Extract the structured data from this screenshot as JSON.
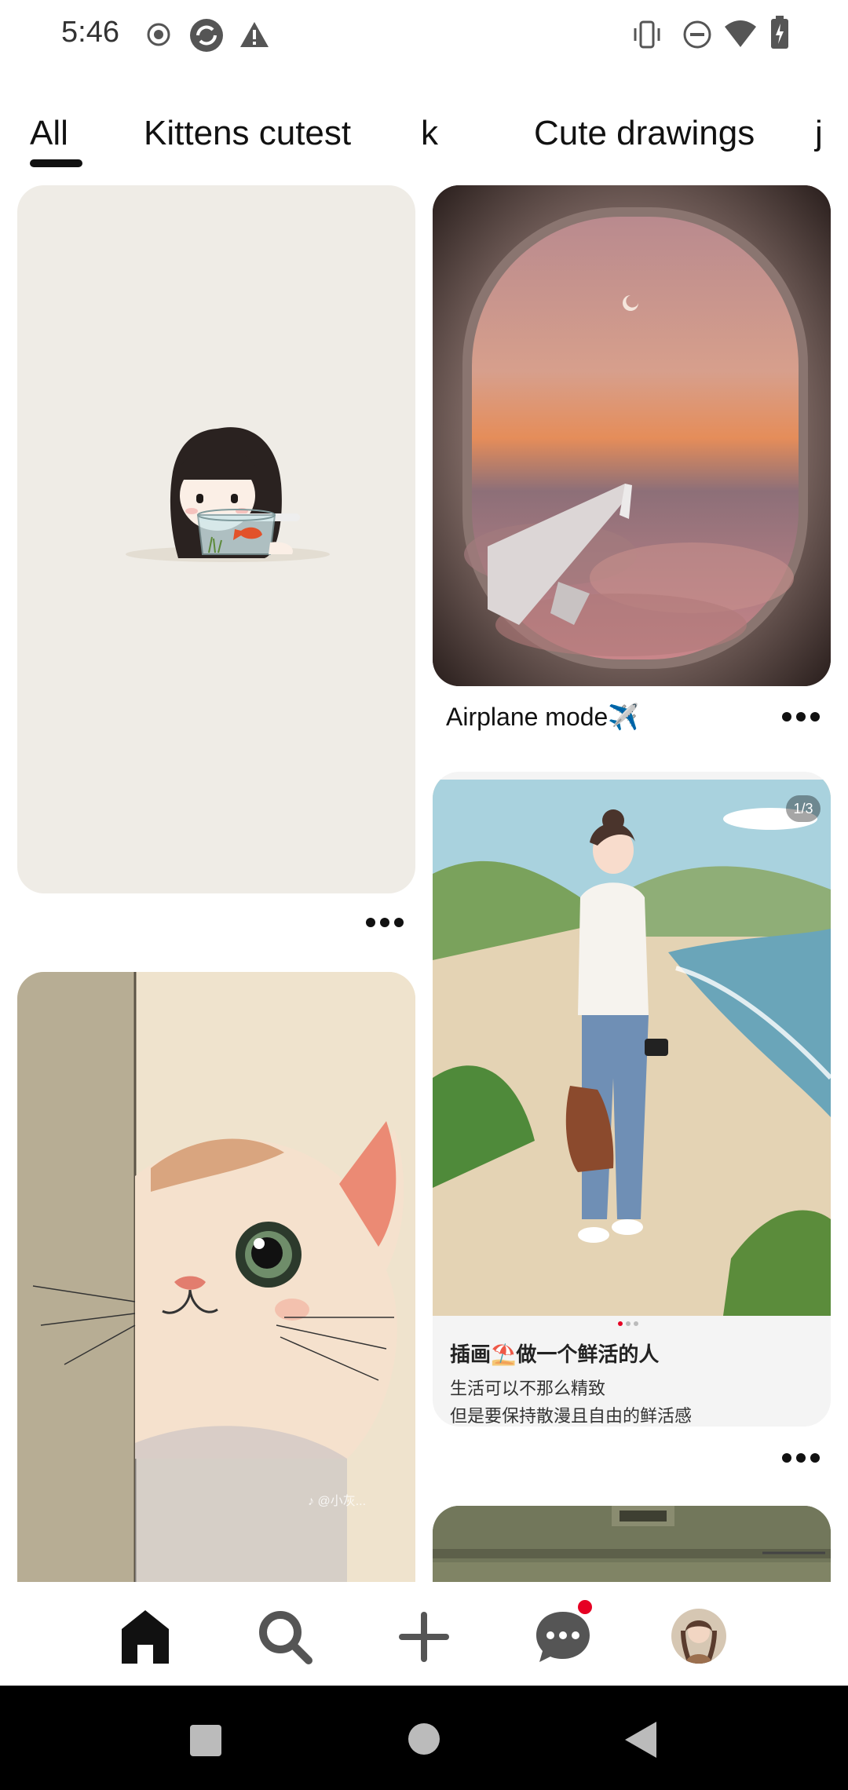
{
  "status_bar": {
    "time": "5:46",
    "left_icons": [
      "record-icon",
      "sync-icon",
      "alert-icon"
    ],
    "right_icons": [
      "vibrate-icon",
      "dnd-icon",
      "wifi-icon",
      "battery-charging-icon"
    ]
  },
  "tabs": [
    {
      "label": "All",
      "selected": true
    },
    {
      "label": "Kittens cutest",
      "selected": false
    },
    {
      "label": "k",
      "selected": false
    },
    {
      "label": "Cute drawings",
      "selected": false
    },
    {
      "label": "j",
      "selected": false
    }
  ],
  "pins": {
    "girl_fishbowl": {
      "title": ""
    },
    "airplane": {
      "title": "Airplane mode✈️"
    },
    "beach_girl": {
      "page_indicator": "1/3",
      "title": "插画⛱️做一个鲜活的人",
      "line1": "生活可以不那么精致",
      "line2": "但是要保持散漫且自由的鲜活感"
    },
    "cat": {
      "watermark": "♪ @小灰..."
    }
  },
  "bottom_nav": {
    "items": [
      "home-icon",
      "search-icon",
      "create-icon",
      "messages-icon",
      "profile-avatar"
    ],
    "active": "home-icon",
    "messages_has_notification": true
  },
  "colors": {
    "accent_red": "#e60023",
    "text": "#111111"
  }
}
